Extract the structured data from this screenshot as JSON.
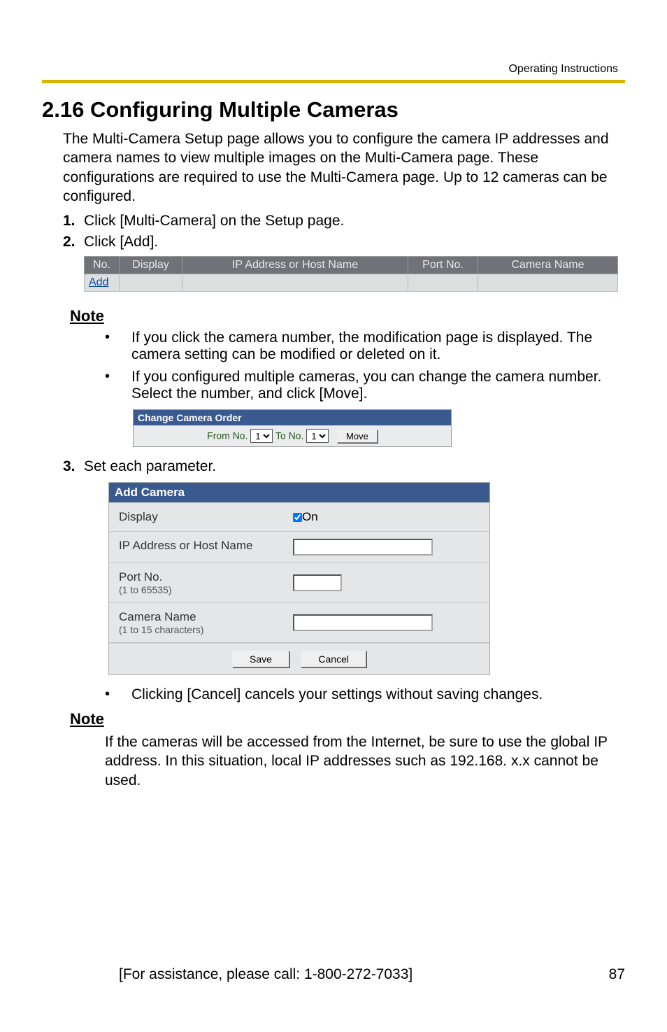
{
  "header": "Operating Instructions",
  "title": "2.16  Configuring Multiple Cameras",
  "intro": "The Multi-Camera Setup page allows you to configure the camera IP addresses and camera names to view multiple images on the Multi-Camera page. These configurations are required to use the Multi-Camera page. Up to 12 cameras can be configured.",
  "steps": {
    "s1_num": "1.",
    "s1_text": "Click [Multi-Camera] on the Setup page.",
    "s2_num": "2.",
    "s2_text": "Click [Add].",
    "s3_num": "3.",
    "s3_text": "Set each parameter."
  },
  "camtable": {
    "h_no": "No.",
    "h_disp": "Display",
    "h_ip": "IP Address or Host Name",
    "h_port": "Port No.",
    "h_cam": "Camera Name",
    "add_link": "Add"
  },
  "note_label": "Note",
  "notes1": {
    "b1": "If you click the camera number, the modification page is displayed. The camera setting can be modified or deleted on it.",
    "b2": "If you configured multiple cameras, you can change the camera number. Select the number, and click [Move]."
  },
  "change_order": {
    "title": "Change Camera Order",
    "from": "From No.",
    "to": " To No.",
    "sel1": "1",
    "sel2": "1",
    "move": "Move"
  },
  "add_camera": {
    "title": "Add Camera",
    "display": "Display",
    "on": " On",
    "ip": "IP Address or Host Name",
    "port": "Port No.",
    "port_hint": "(1 to 65535)",
    "name": "Camera Name",
    "name_hint": "(1 to 15 characters)",
    "save": "Save",
    "cancel": "Cancel"
  },
  "after_bullet": "Clicking [Cancel] cancels your settings without saving changes.",
  "note2": "If the cameras will be accessed from the Internet, be sure to use the global IP address. In this situation, local IP addresses such as 192.168. x.x cannot be used.",
  "footer": {
    "assist": "[For assistance, please call: 1-800-272-7033]",
    "page": "87"
  }
}
